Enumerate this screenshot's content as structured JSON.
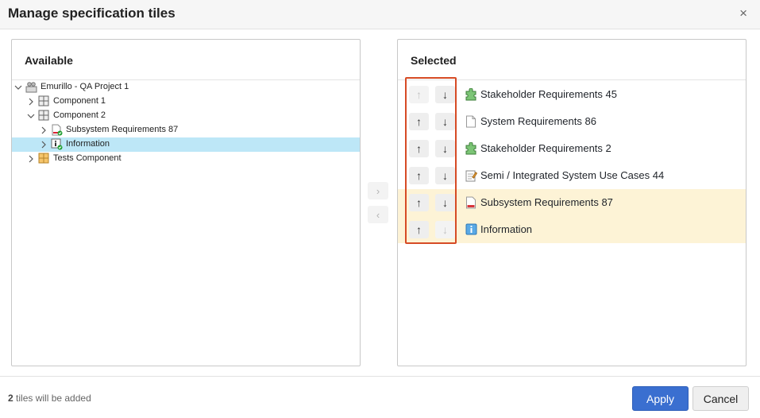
{
  "dialog": {
    "title": "Manage specification tiles",
    "close_glyph": "×"
  },
  "available": {
    "heading": "Available",
    "tree": [
      {
        "label": "Emurillo - QA Project 1",
        "icon": "project-icon",
        "expander": "expanded",
        "depth": 0
      },
      {
        "label": "Component 1",
        "icon": "component-grid-icon",
        "expander": "collapsed",
        "depth": 1
      },
      {
        "label": "Component 2",
        "icon": "component-grid-icon",
        "expander": "expanded",
        "depth": 1
      },
      {
        "label": "Subsystem Requirements 87",
        "icon": "document-added-icon",
        "expander": "collapsed",
        "depth": 2
      },
      {
        "label": "Information",
        "icon": "info-added-icon",
        "expander": "collapsed",
        "depth": 2,
        "selected": true
      },
      {
        "label": "Tests Component",
        "icon": "tests-component-icon",
        "expander": "collapsed",
        "depth": 1
      }
    ]
  },
  "transfer": {
    "add_glyph": "›",
    "remove_glyph": "‹"
  },
  "selected": {
    "heading": "Selected",
    "items": [
      {
        "label": "Stakeholder Requirements 45",
        "icon": "puzzle-icon",
        "up_enabled": false,
        "down_enabled": true,
        "new": false
      },
      {
        "label": "System Requirements 86",
        "icon": "page-icon",
        "up_enabled": true,
        "down_enabled": true,
        "new": false
      },
      {
        "label": "Stakeholder Requirements 2",
        "icon": "puzzle-icon",
        "up_enabled": true,
        "down_enabled": true,
        "new": false
      },
      {
        "label": "Semi / Integrated System Use Cases 44",
        "icon": "use-case-icon",
        "up_enabled": true,
        "down_enabled": true,
        "new": false
      },
      {
        "label": "Subsystem Requirements 87",
        "icon": "document-red-icon",
        "up_enabled": true,
        "down_enabled": true,
        "new": true
      },
      {
        "label": "Information",
        "icon": "info-icon",
        "up_enabled": true,
        "down_enabled": false,
        "new": true
      }
    ],
    "up_glyph": "↑",
    "down_glyph": "↓"
  },
  "footer": {
    "status_count": "2",
    "status_text": " tiles will be added",
    "apply_label": "Apply",
    "cancel_label": "Cancel"
  },
  "colors": {
    "apply_button": "#3a6fd0",
    "selected_tree_row": "#bde7f7",
    "new_item_highlight": "#fdf3d6",
    "annotation_box": "#d64b25"
  }
}
